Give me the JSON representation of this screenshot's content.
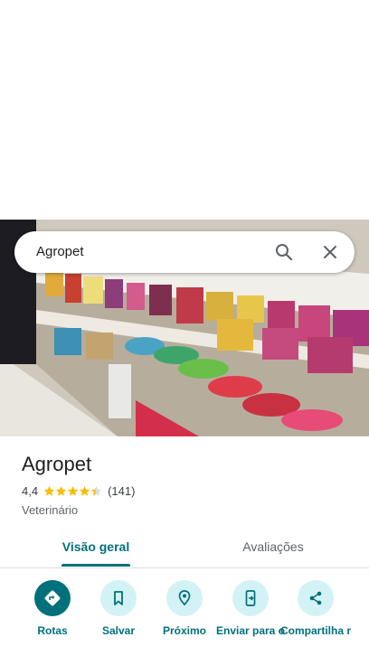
{
  "search": {
    "query": "Agropet"
  },
  "place": {
    "name": "Agropet",
    "rating": "4,4",
    "review_count": "(141)",
    "star_fill": 4.4,
    "category": "Veterinário"
  },
  "tabs": [
    {
      "label": "Visão geral",
      "selected": true
    },
    {
      "label": "Avaliações",
      "selected": false
    }
  ],
  "actions": [
    {
      "label": "Rotas",
      "icon": "directions-icon"
    },
    {
      "label": "Salvar",
      "icon": "bookmark-icon"
    },
    {
      "label": "Próximo",
      "icon": "nearby-icon"
    },
    {
      "label": "Enviar para o",
      "icon": "send-to-phone-icon"
    },
    {
      "label": "Compartilha r",
      "icon": "share-icon"
    }
  ],
  "colors": {
    "accent": "#00707a",
    "accent_light": "#d3f2f6",
    "star": "#fbbc04"
  }
}
